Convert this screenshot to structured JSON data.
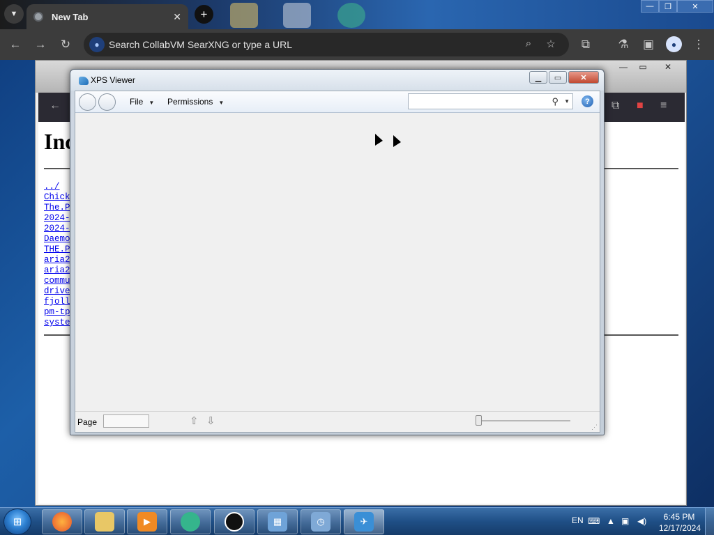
{
  "browser": {
    "tab_title": "New Tab",
    "omnibox_placeholder": "Search CollabVM SearXNG or type a URL",
    "window_controls": {
      "minimize": "—",
      "restore": "❐",
      "close": "✕"
    }
  },
  "background_page": {
    "heading": "Inc",
    "links": [
      "../",
      "Chick",
      "The.P",
      "2024-",
      "2024-",
      "Daemo",
      "THE.P",
      "aria2",
      "aria2",
      "commu",
      "drive",
      "fjoll",
      "pm-tp",
      "syste"
    ]
  },
  "xps_viewer": {
    "title": "XPS Viewer",
    "menu_file": "File",
    "menu_permissions": "Permissions",
    "search_placeholder": "",
    "help": "?",
    "page_label": "Page",
    "page_value": ""
  },
  "taskbar": {
    "language": "EN",
    "time": "6:45 PM",
    "date": "12/17/2024",
    "apps": [
      "firefox-icon",
      "file-explorer-icon",
      "media-player-icon",
      "browser-icon",
      "app-icon",
      "control-panel-icon",
      "scheduler-icon",
      "xps-viewer-icon"
    ]
  },
  "colors": {
    "chrome_toolbar": "#3c3c3c",
    "link": "#0000ee",
    "taskbar": "#1f4f86"
  }
}
